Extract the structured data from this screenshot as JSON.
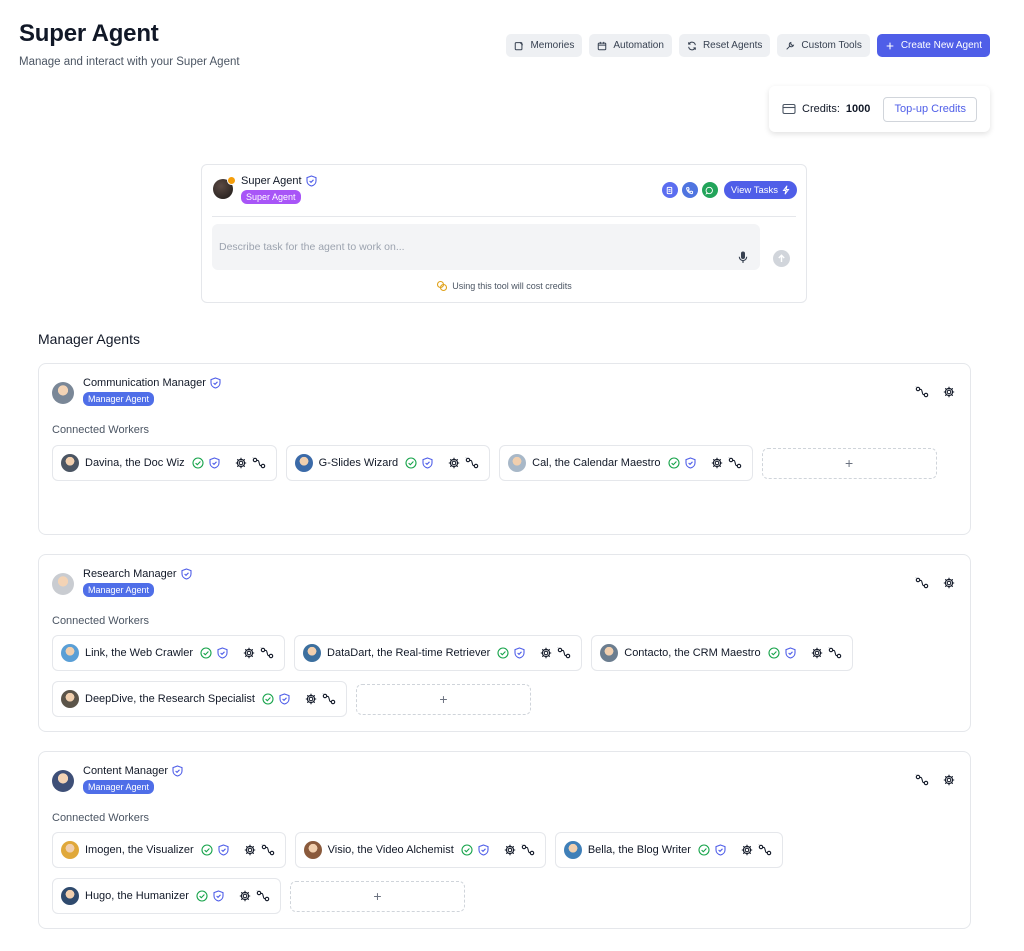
{
  "header": {
    "title": "Super Agent",
    "subtitle": "Manage and interact with your Super Agent"
  },
  "toolbar": {
    "memories": "Memories",
    "automation": "Automation",
    "reset_agents": "Reset Agents",
    "custom_tools": "Custom Tools",
    "create_new_agent": "Create New Agent"
  },
  "credits": {
    "label": "Credits:",
    "value": "1000",
    "topup": "Top-up Credits"
  },
  "super_agent": {
    "name": "Super Agent",
    "tag": "Super Agent",
    "view_tasks": "View Tasks",
    "input_placeholder": "Describe task for the agent to work on...",
    "cost_note": "Using this tool will cost credits"
  },
  "section_title": "Manager Agents",
  "connected_workers_label": "Connected Workers",
  "managers": [
    {
      "name": "Communication Manager",
      "tag": "Manager Agent",
      "avatar_color": "#7a8797",
      "workers": [
        {
          "name": "Davina, the Doc Wiz",
          "avatar_color": "#4b5563"
        },
        {
          "name": "G-Slides Wizard",
          "avatar_color": "#3b6aa8"
        },
        {
          "name": "Cal, the Calendar Maestro",
          "avatar_color": "#a8b8c8"
        }
      ]
    },
    {
      "name": "Research Manager",
      "tag": "Manager Agent",
      "avatar_color": "#c9ccd1",
      "workers": [
        {
          "name": "Link, the Web Crawler",
          "avatar_color": "#5a9fd6"
        },
        {
          "name": "DataDart, the Real-time Retriever",
          "avatar_color": "#3c6f9e"
        },
        {
          "name": "Contacto, the CRM Maestro",
          "avatar_color": "#6b7d8f"
        },
        {
          "name": "DeepDive, the Research Specialist",
          "avatar_color": "#5b5449"
        }
      ]
    },
    {
      "name": "Content Manager",
      "tag": "Manager Agent",
      "avatar_color": "#3e4f77",
      "workers": [
        {
          "name": "Imogen, the Visualizer",
          "avatar_color": "#e0a83a"
        },
        {
          "name": "Visio, the Video Alchemist",
          "avatar_color": "#8a5a3c"
        },
        {
          "name": "Bella, the Blog Writer",
          "avatar_color": "#3f7fb8"
        },
        {
          "name": "Hugo, the Humanizer",
          "avatar_color": "#2f4a6d"
        }
      ]
    }
  ],
  "add_label": "+",
  "colors": {
    "accent": "#4f5ee8",
    "tag_purple": "#a855f7",
    "tag_blue": "#4f6ee8",
    "check_green": "#16a34a",
    "shield_blue": "#4f5ee8"
  }
}
